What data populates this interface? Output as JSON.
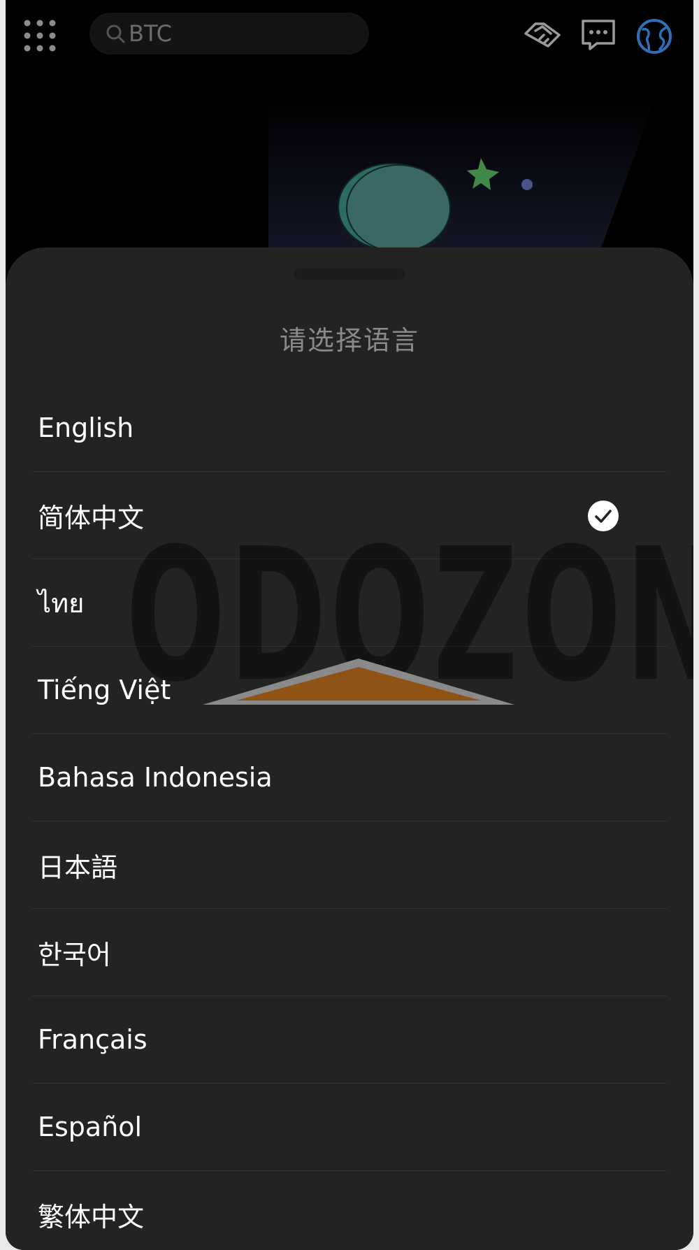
{
  "colors": {
    "background": "#000000",
    "sheet": "#232323",
    "title_text": "#8a8a8a",
    "item_text": "#ffffff",
    "divider": "#333333",
    "globe_accent": "#2f6fb5",
    "check_bg": "#ffffff"
  },
  "topbar": {
    "apps_icon": "grid-dots-icon",
    "search": {
      "placeholder": "BTC",
      "icon": "search-icon"
    },
    "icons": [
      "handshake-icon",
      "message-icon",
      "globe-icon"
    ]
  },
  "sheet": {
    "title": "请选择语言",
    "languages": [
      {
        "label": "English",
        "selected": false
      },
      {
        "label": "简体中文",
        "selected": true
      },
      {
        "label": "ไทย",
        "selected": false
      },
      {
        "label": "Tiếng Việt",
        "selected": false
      },
      {
        "label": "Bahasa Indonesia",
        "selected": false
      },
      {
        "label": "日本語",
        "selected": false
      },
      {
        "label": "한국어",
        "selected": false
      },
      {
        "label": "Français",
        "selected": false
      },
      {
        "label": "Español",
        "selected": false
      },
      {
        "label": "繁体中文",
        "selected": false
      }
    ],
    "selected_icon": "check-circle-icon"
  },
  "watermark": {
    "text": "ODOZON"
  }
}
